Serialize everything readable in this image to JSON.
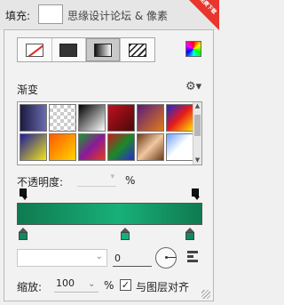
{
  "topbar": {
    "fill_label": "填充:",
    "watermark_text": "思缘设计论坛 & 像素",
    "badge_text": "免费下载"
  },
  "fill_types": [
    {
      "name": "none",
      "icon": "no-fill-icon",
      "active": false
    },
    {
      "name": "solid",
      "icon": "solid-color-icon",
      "active": false
    },
    {
      "name": "gradient",
      "icon": "gradient-icon",
      "active": true
    },
    {
      "name": "pattern",
      "icon": "pattern-icon",
      "active": false
    }
  ],
  "gradient": {
    "title": "渐变",
    "preset_colors": [
      "linear-gradient(90deg,#1a1a40,#6b6bb0)",
      "repeating-conic-gradient(#ccc 0 25%,#fff 0 50%) 0 0/8px 8px",
      "linear-gradient(135deg,#000,#fff)",
      "linear-gradient(135deg,#c0101f,#4a0a0a)",
      "linear-gradient(135deg,#5a1b7a,#e07c1a)",
      "linear-gradient(135deg,#1a2ad0,#e81a1a,#ffe100)",
      "linear-gradient(135deg,#1c1c9a,#f2e41a)",
      "linear-gradient(135deg,#ff5a00,#ffd400)",
      "linear-gradient(135deg,#1a9a2a,#8a1a9a,#e83a1a)",
      "linear-gradient(135deg,#c81a1a,#1a8a2a,#2a2ad0)",
      "linear-gradient(135deg,#6b3a1a,#f0c8a0,#6b3a1a)",
      "linear-gradient(135deg,#6aa0ff,#fff,#fff)"
    ]
  },
  "opacity": {
    "label": "不透明度:",
    "value": "",
    "unit": "%"
  },
  "ramp": {
    "start_color": "#0f7a50",
    "mid_color": "#18b079",
    "end_color": "#0f7a50"
  },
  "location": {
    "value": "0"
  },
  "scale": {
    "label": "缩放:",
    "value": "100",
    "unit": "%"
  },
  "align_with_layer": {
    "checked": true,
    "label": "与图层对齐"
  }
}
